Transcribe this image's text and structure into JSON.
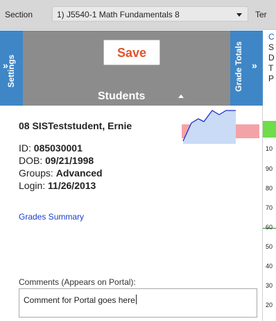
{
  "section_bar": {
    "label": "Section",
    "selected": "1) J5540-1 Math Fundamentals 8",
    "term_label": "Ter"
  },
  "settings_tab": {
    "label": "Settings",
    "icon": "double-chevron-right-icon"
  },
  "students_header": {
    "save_label": "Save",
    "title": "Students",
    "sort_icon": "caret-up-icon"
  },
  "grade_totals_tab": {
    "label": "Grade Totals",
    "icon": "double-chevron-right-icon"
  },
  "right_strip_letters": [
    "C",
    "S",
    "D",
    "T",
    "P"
  ],
  "student": {
    "name": "08 SISTeststudent, Ernie",
    "id_label": "ID:",
    "id_value": "085030001",
    "dob_label": "DOB:",
    "dob_value": "09/21/1998",
    "groups_label": "Groups:",
    "groups_value": "Advanced",
    "login_label": "Login:",
    "login_value": "11/26/2013",
    "grades_summary_link": "Grades Summary",
    "comments_label": "Comments (Appears on Portal):",
    "comments_value": "Comment for Portal goes here"
  },
  "chart_strip_ticks": [
    "10",
    "90",
    "80",
    "70",
    "60",
    "50",
    "40",
    "30",
    "20"
  ],
  "colors": {
    "tab_blue": "#3f86c6",
    "header_gray": "#8c8c8c",
    "save_orange": "#e0532b",
    "link_blue": "#1a3fcc",
    "chart_green": "#6fdc4a",
    "spark_fill": "#c9dbf5",
    "spark_line": "#1f2fcc",
    "spark_red": "#f3a3a8"
  }
}
